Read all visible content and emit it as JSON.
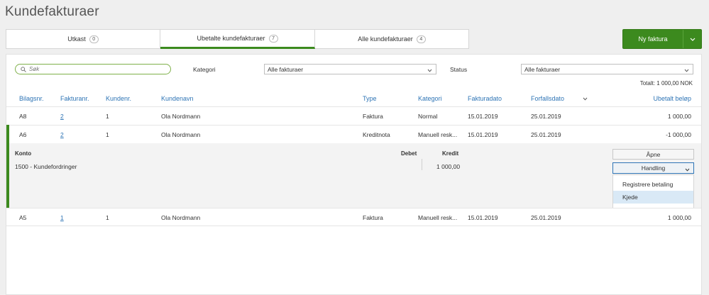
{
  "page": {
    "title": "Kundefakturaer"
  },
  "tabs": [
    {
      "label": "Utkast",
      "count": "0"
    },
    {
      "label": "Ubetalte kundefakturaer",
      "count": "7"
    },
    {
      "label": "Alle kundefakturaer",
      "count": "4"
    }
  ],
  "new_button": {
    "label": "Ny faktura"
  },
  "filters": {
    "search_placeholder": "Søk",
    "category_label": "Kategori",
    "category_value": "Alle fakturaer",
    "status_label": "Status",
    "status_value": "Alle fakturaer"
  },
  "total": "Totalt: 1 000,00 NOK",
  "columns": {
    "bilagsnr": "Bilagsnr.",
    "fakturanr": "Fakturanr.",
    "kundenr": "Kundenr.",
    "kundenavn": "Kundenavn",
    "type": "Type",
    "kategori": "Kategori",
    "fakturadato": "Fakturadato",
    "forfallsdato": "Forfallsdato",
    "ubetalt": "Ubetalt beløp"
  },
  "rows": [
    {
      "bilagsnr": "A8",
      "fakturanr": "2",
      "kundenr": "1",
      "kundenavn": "Ola Nordmann",
      "type": "Faktura",
      "kategori": "Normal",
      "fakturadato": "15.01.2019",
      "forfallsdato": "25.01.2019",
      "ubetalt": "1 000,00"
    },
    {
      "bilagsnr": "A6",
      "fakturanr": "2",
      "kundenr": "1",
      "kundenavn": "Ola Nordmann",
      "type": "Kreditnota",
      "kategori": "Manuell resk...",
      "fakturadato": "15.01.2019",
      "forfallsdato": "25.01.2019",
      "ubetalt": "-1 000,00"
    },
    {
      "bilagsnr": "A5",
      "fakturanr": "1",
      "kundenr": "1",
      "kundenavn": "Ola Nordmann",
      "type": "Faktura",
      "kategori": "Manuell resk...",
      "fakturadato": "15.01.2019",
      "forfallsdato": "25.01.2019",
      "ubetalt": "1 000,00"
    }
  ],
  "detail": {
    "konto_label": "Konto",
    "debet_label": "Debet",
    "kredit_label": "Kredit",
    "konto_value": "1500 - Kundefordringer",
    "kredit_value": "1 000,00",
    "open_button": "Åpne",
    "action_button": "Handling",
    "menu_items": [
      "Registrere betaling",
      "Kjede"
    ]
  },
  "colors": {
    "accent_green": "#3c8a1e",
    "link_blue": "#2e74b5",
    "menu_highlight": "#d9e9f6"
  }
}
